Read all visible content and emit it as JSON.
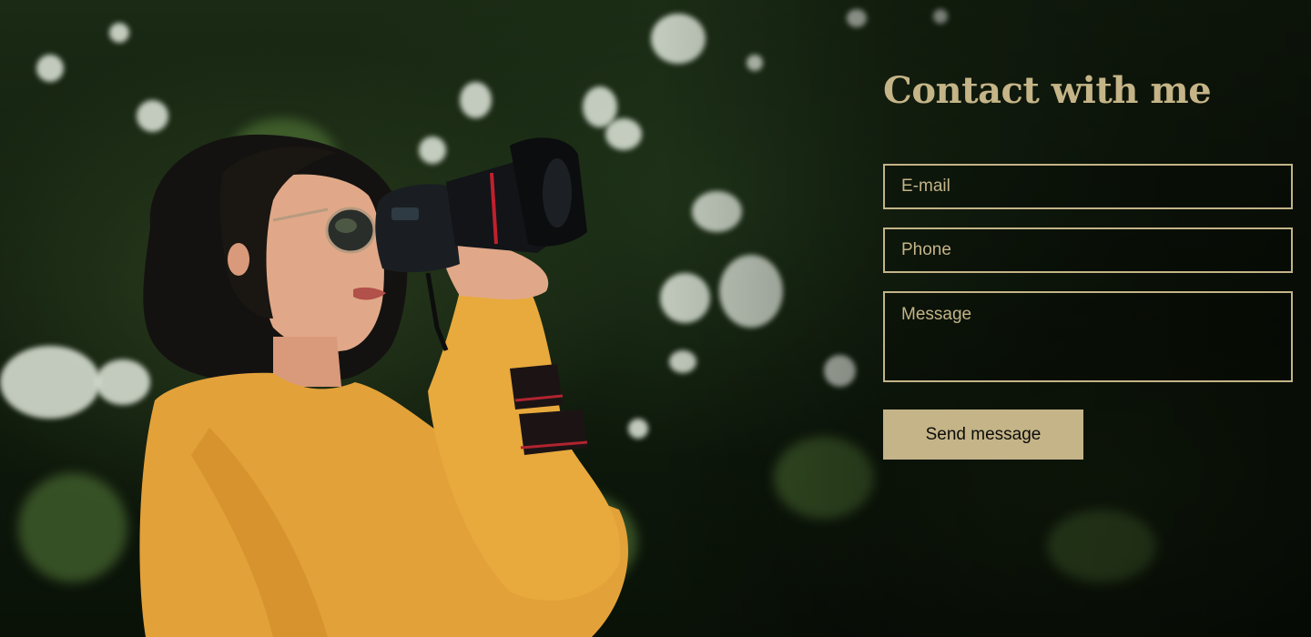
{
  "contact": {
    "title": "Contact with me",
    "email_placeholder": "E-mail",
    "phone_placeholder": "Phone",
    "message_placeholder": "Message",
    "send_label": "Send message"
  },
  "colors": {
    "accent": "#c4b487",
    "button_text": "#0c0c0c",
    "background": "#0b140b"
  },
  "hero": {
    "background_image": "photographer-with-camera-among-trees"
  }
}
